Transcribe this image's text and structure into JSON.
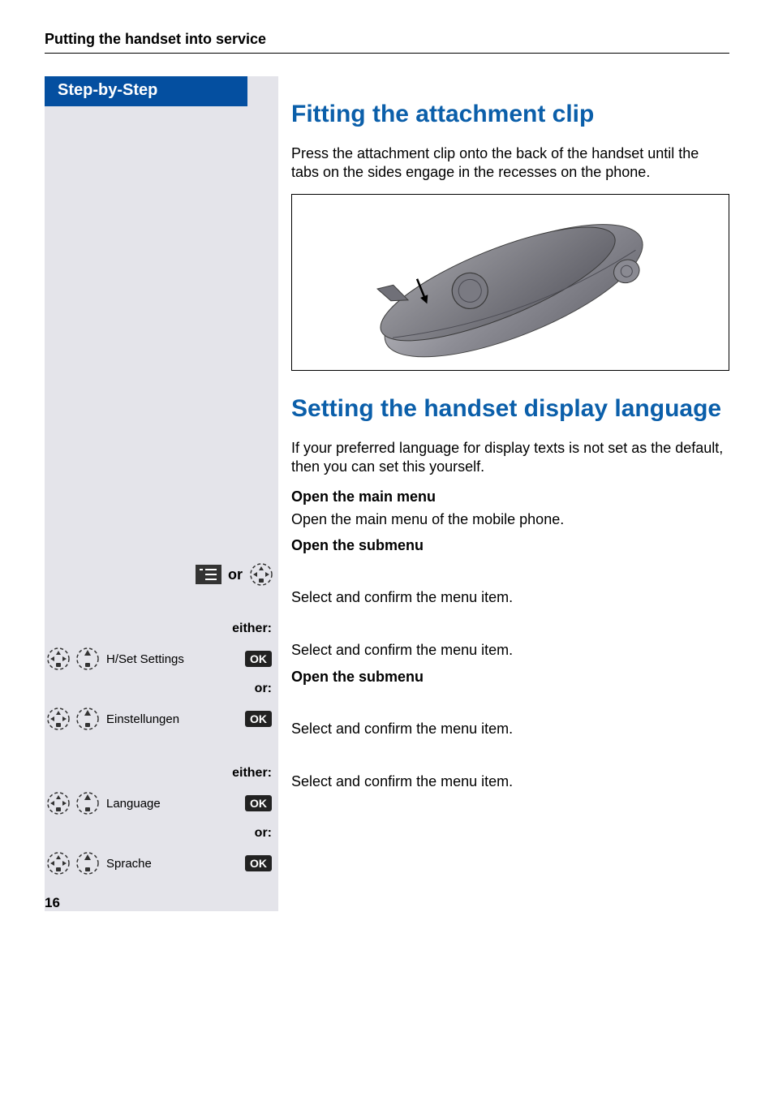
{
  "header": {
    "section_title": "Putting the handset into service"
  },
  "sidebar": {
    "tab_label": "Step-by-Step",
    "or_word": "or",
    "either_label": "either:",
    "or_label": "or:",
    "ok_label": "OK",
    "rows": {
      "hset": "H/Set Settings",
      "einstellungen": "Einstellungen",
      "language": "Language",
      "sprache": "Sprache"
    }
  },
  "main": {
    "h1_clip": "Fitting the attachment clip",
    "clip_text": "Press the attachment clip onto the back of the handset until the tabs on the sides engage in the recesses on the phone.",
    "h1_lang": "Setting the handset display language",
    "lang_intro": "If your preferred language for display texts is not set as the default, then you can set this yourself.",
    "open_main_menu": "Open the main menu",
    "open_main_menu_text": "Open the main menu of the mobile phone.",
    "open_submenu": "Open the submenu",
    "select_confirm": "Select and confirm the menu item."
  },
  "page_number": "16"
}
